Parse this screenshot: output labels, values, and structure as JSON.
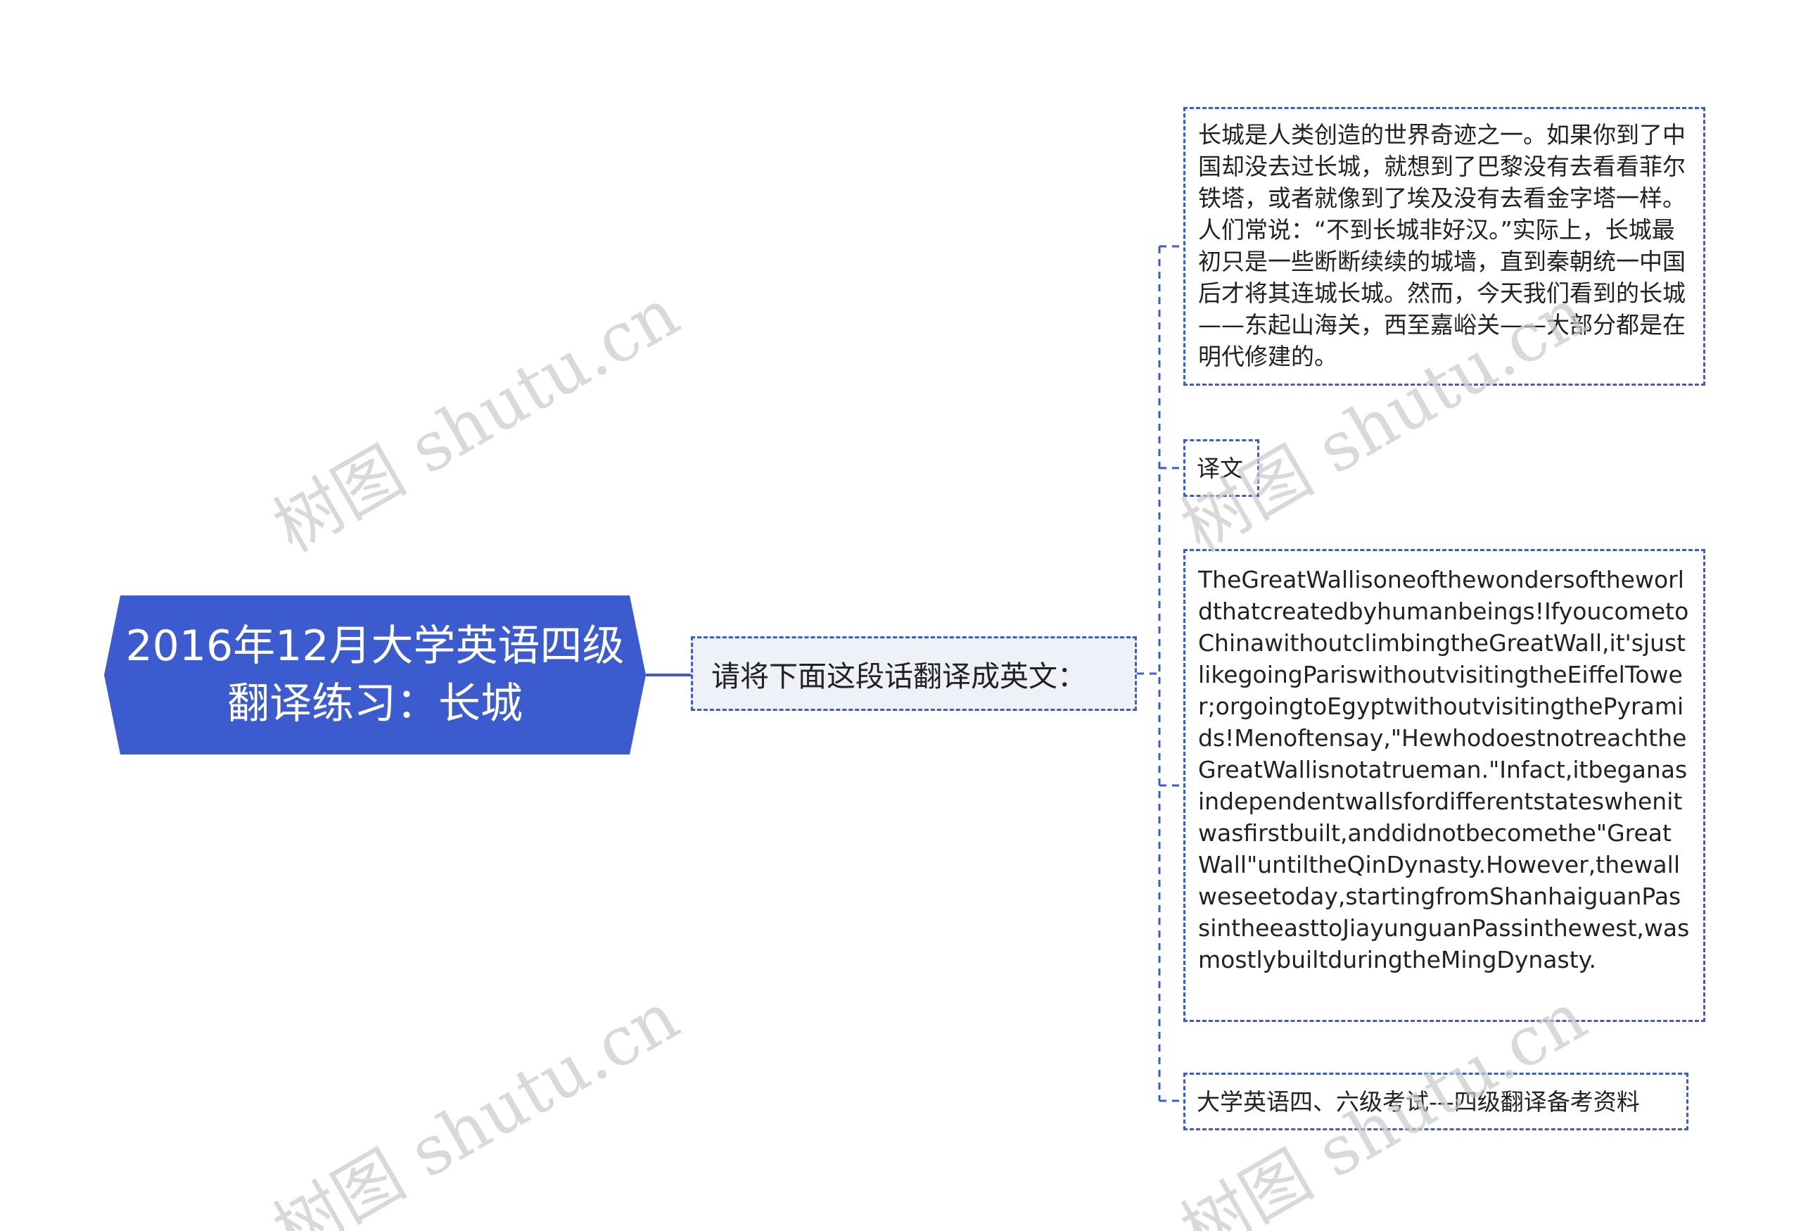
{
  "diagram": {
    "root": {
      "label": "2016年12月大学英语四级\n翻译练习：长城"
    },
    "prompt": {
      "label": "请将下面这段话翻译成英文："
    },
    "leaves": {
      "chinese_text": "长城是人类创造的世界奇迹之一。如果你到了中国却没去过长城，就想到了巴黎没有去看看菲尔铁塔，或者就像到了埃及没有去看金字塔一样。人们常说：“不到长城非好汉。”实际上，长城最初只是一些断断续续的城墙，直到秦朝统一中国后才将其连城长城。然而，今天我们看到的长城——东起山海关，西至嘉峪关——大部分都是在明代修建的。",
      "translation_label": "译文",
      "english_text": "TheGreatWallisoneofthewondersoftheworldthatcreatedbyhumanbeings!IfyoucometoChinawithoutclimbingtheGreatWall,it'sjustlikegoingPariswithoutvisitingtheEiffelTower;orgoingtoEgyptwithoutvisitingthePyramids!Menoftensay,\"HewhodoestnotreachtheGreatWallisnotatrueman.\"Infact,itbeganasindependentwallsfordifferentstateswhenitwasfirstbuilt,anddidnotbecomethe\"GreatWall\"untiltheQinDynasty.However,thewallweseetoday,startingfromShanhaiguanPassintheeasttoJiayunguanPassinthewest,wasmostlybuiltduringtheMingDynasty.",
      "reference": "大学英语四、六级考试---四级翻译备考资料"
    },
    "colors": {
      "root_fill": "#3b5bce",
      "prompt_fill": "#eef2f8",
      "border": "#3b5bce",
      "connector": "#3b5bce"
    }
  },
  "watermark": {
    "text": "树图 shutu.cn"
  }
}
